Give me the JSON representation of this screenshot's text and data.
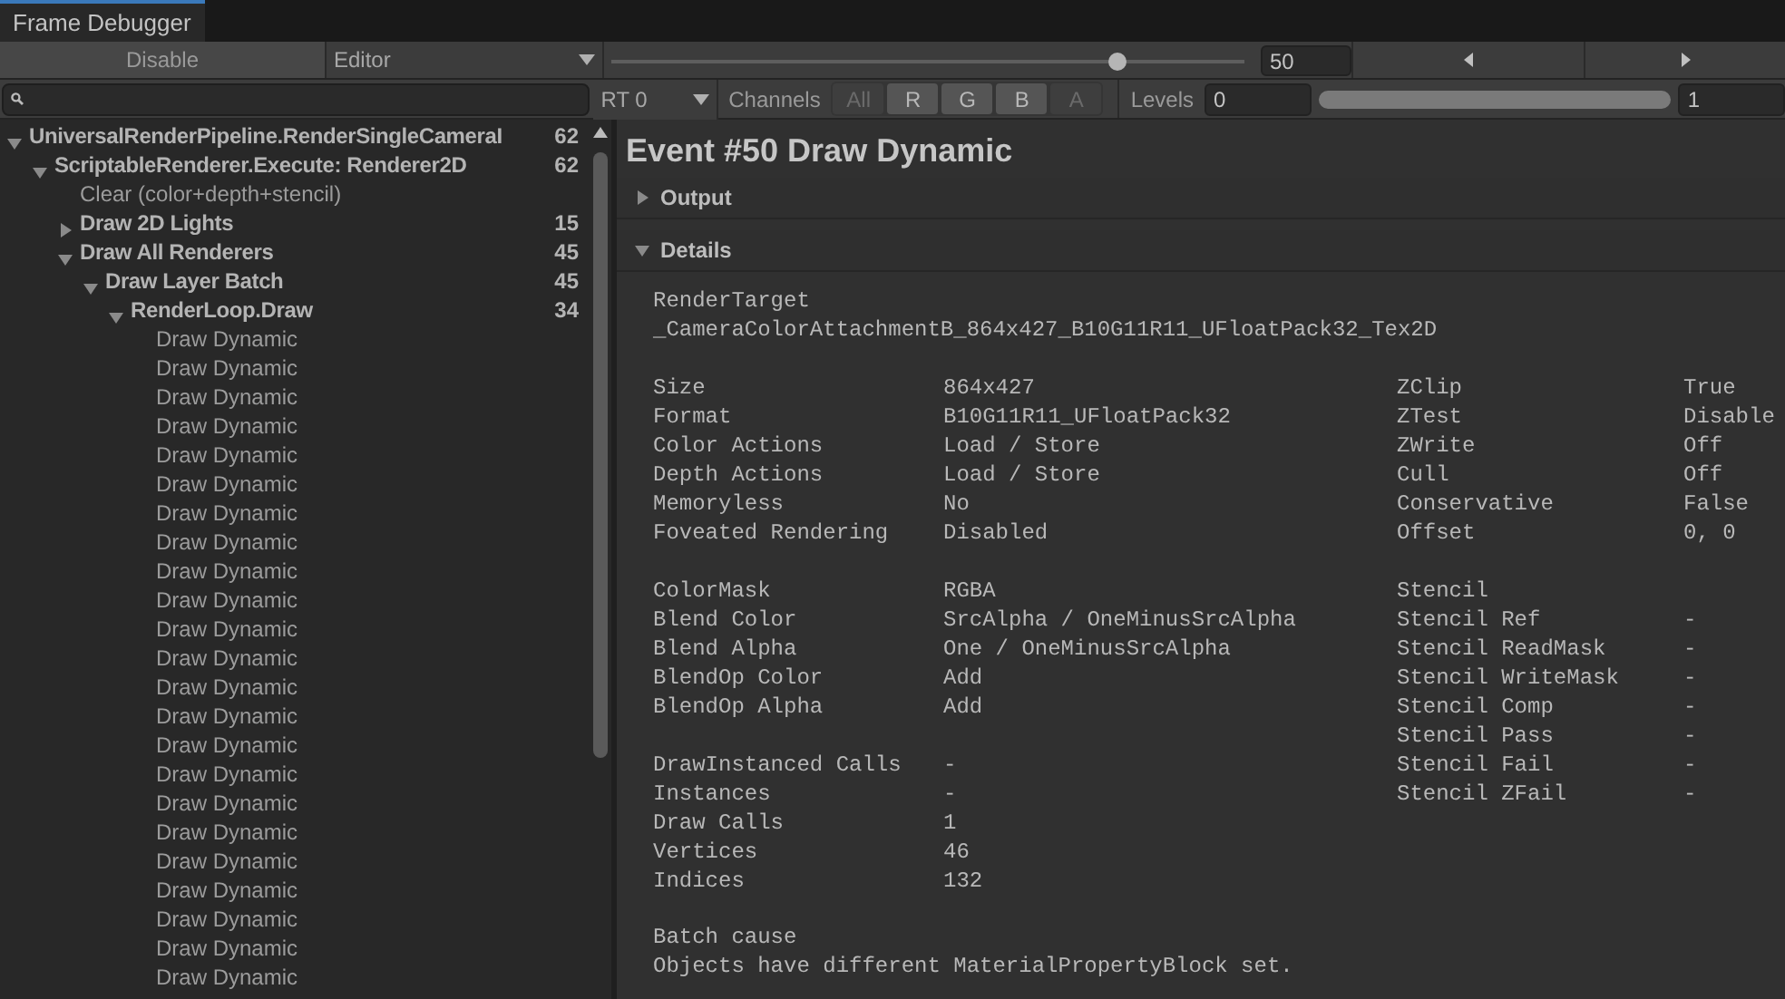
{
  "window": {
    "tab": "Frame Debugger"
  },
  "toolbar": {
    "enable_button": "Disable",
    "target_dropdown": "Editor",
    "event_slider": {
      "level": 0.8
    },
    "event_field": "50"
  },
  "render_toolbar": {
    "rt_dropdown": "RT 0",
    "channels_label": "Channels",
    "channels": [
      {
        "label": "All",
        "selected": false
      },
      {
        "label": "R",
        "selected": true
      },
      {
        "label": "G",
        "selected": true
      },
      {
        "label": "B",
        "selected": true
      },
      {
        "label": "A",
        "selected": false
      }
    ],
    "levels_label": "Levels",
    "levels_min": "0",
    "levels_range": {
      "level": 1
    },
    "levels_max": "1"
  },
  "tree": [
    {
      "kind": "group",
      "label": "UniversalRenderPipeline.RenderSingleCameraI",
      "count": "62",
      "expanded": true,
      "children": [
        {
          "kind": "group",
          "label": "ScriptableRenderer.Execute: Renderer2D",
          "count": "62",
          "expanded": true,
          "children": [
            {
              "kind": "leaf",
              "label": "Clear (color+depth+stencil)"
            },
            {
              "kind": "group",
              "label": "Draw 2D Lights",
              "count": "15",
              "expanded": false
            },
            {
              "kind": "group",
              "label": "Draw All Renderers",
              "count": "45",
              "expanded": true,
              "children": [
                {
                  "kind": "group",
                  "label": "Draw Layer Batch",
                  "count": "45",
                  "expanded": true,
                  "children": [
                    {
                      "kind": "group",
                      "label": "RenderLoop.Draw",
                      "count": "34",
                      "expanded": true,
                      "children": [
                        {
                          "kind": "leaf",
                          "label": "Draw Dynamic"
                        },
                        {
                          "kind": "leaf",
                          "label": "Draw Dynamic"
                        },
                        {
                          "kind": "leaf",
                          "label": "Draw Dynamic"
                        },
                        {
                          "kind": "leaf",
                          "label": "Draw Dynamic"
                        },
                        {
                          "kind": "leaf",
                          "label": "Draw Dynamic"
                        },
                        {
                          "kind": "leaf",
                          "label": "Draw Dynamic"
                        },
                        {
                          "kind": "leaf",
                          "label": "Draw Dynamic"
                        },
                        {
                          "kind": "leaf",
                          "label": "Draw Dynamic"
                        },
                        {
                          "kind": "leaf",
                          "label": "Draw Dynamic"
                        },
                        {
                          "kind": "leaf",
                          "label": "Draw Dynamic"
                        },
                        {
                          "kind": "leaf",
                          "label": "Draw Dynamic"
                        },
                        {
                          "kind": "leaf",
                          "label": "Draw Dynamic"
                        },
                        {
                          "kind": "leaf",
                          "label": "Draw Dynamic"
                        },
                        {
                          "kind": "leaf",
                          "label": "Draw Dynamic"
                        },
                        {
                          "kind": "leaf",
                          "label": "Draw Dynamic"
                        },
                        {
                          "kind": "leaf",
                          "label": "Draw Dynamic"
                        },
                        {
                          "kind": "leaf",
                          "label": "Draw Dynamic"
                        },
                        {
                          "kind": "leaf",
                          "label": "Draw Dynamic"
                        },
                        {
                          "kind": "leaf",
                          "label": "Draw Dynamic"
                        },
                        {
                          "kind": "leaf",
                          "label": "Draw Dynamic"
                        },
                        {
                          "kind": "leaf",
                          "label": "Draw Dynamic"
                        },
                        {
                          "kind": "leaf",
                          "label": "Draw Dynamic"
                        },
                        {
                          "kind": "leaf",
                          "label": "Draw Dynamic"
                        }
                      ]
                    }
                  ]
                }
              ]
            }
          ]
        }
      ]
    }
  ],
  "event_title": "Event #50 Draw Dynamic",
  "foldouts": [
    {
      "label": "Output",
      "expanded": false
    },
    {
      "label": "Details",
      "expanded": true
    }
  ],
  "details": {
    "render_target_label": "RenderTarget",
    "render_target_value": "_CameraColorAttachmentB_864x427_B10G11R11_UFloatPack32_Tex2D",
    "left_blocks": [
      [
        {
          "label": "Size",
          "value": "864x427"
        },
        {
          "label": "Format",
          "value": "B10G11R11_UFloatPack32"
        },
        {
          "label": "Color Actions",
          "value": "Load / Store"
        },
        {
          "label": "Depth Actions",
          "value": "Load / Store"
        },
        {
          "label": "Memoryless",
          "value": "No"
        },
        {
          "label": "Foveated Rendering",
          "value": "Disabled"
        }
      ],
      [
        {
          "label": "ColorMask",
          "value": "RGBA"
        },
        {
          "label": "Blend Color",
          "value": "SrcAlpha / OneMinusSrcAlpha"
        },
        {
          "label": "Blend Alpha",
          "value": "One / OneMinusSrcAlpha"
        },
        {
          "label": "BlendOp Color",
          "value": "Add"
        },
        {
          "label": "BlendOp Alpha",
          "value": "Add"
        }
      ],
      [
        {
          "label": "DrawInstanced Calls",
          "value": "-"
        },
        {
          "label": "Instances",
          "value": "-"
        },
        {
          "label": "Draw Calls",
          "value": "1"
        },
        {
          "label": "Vertices",
          "value": "46"
        },
        {
          "label": "Indices",
          "value": "132"
        }
      ]
    ],
    "right_blocks": [
      [
        {
          "label": "ZClip",
          "value": "True"
        },
        {
          "label": "ZTest",
          "value": "Disable"
        },
        {
          "label": "ZWrite",
          "value": "Off"
        },
        {
          "label": "Cull",
          "value": "Off"
        },
        {
          "label": "Conservative",
          "value": "False"
        },
        {
          "label": "Offset",
          "value": "0, 0"
        }
      ],
      [
        {
          "label": "Stencil"
        },
        {
          "label": "Stencil Ref",
          "value": "-"
        },
        {
          "label": "Stencil ReadMask",
          "value": "-"
        },
        {
          "label": "Stencil WriteMask",
          "value": "-"
        },
        {
          "label": "Stencil Comp",
          "value": "-"
        },
        {
          "label": "Stencil Pass",
          "value": "-"
        },
        {
          "label": "Stencil Fail",
          "value": "-"
        },
        {
          "label": "Stencil ZFail",
          "value": "-"
        }
      ]
    ],
    "batch_cause_label": "Batch cause",
    "batch_cause_value": "Objects have different MaterialPropertyBlock set."
  }
}
